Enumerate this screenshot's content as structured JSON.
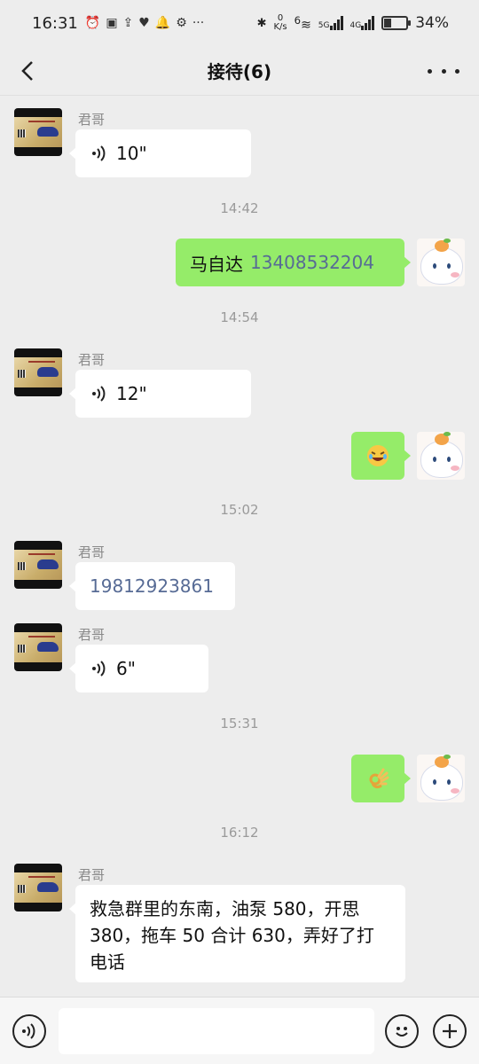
{
  "status_bar": {
    "time": "16:31",
    "net_speed_value": "0",
    "net_speed_unit": "K/s",
    "network_6": "6",
    "network_5g": "5G",
    "network_4g": "4G",
    "battery_percent": "34%",
    "battery_level": 0.34
  },
  "nav": {
    "title": "接待(6)"
  },
  "messages": {
    "m1": {
      "sender": "君哥",
      "voice_duration": "10\""
    },
    "t1": "14:42",
    "m2": {
      "name": "马自达",
      "phone": "13408532204"
    },
    "t2": "14:54",
    "m3": {
      "sender": "君哥",
      "voice_duration": "12\""
    },
    "m4": {
      "emoji": "rolling-on-floor-laughing"
    },
    "t3": "15:02",
    "m5": {
      "sender": "君哥",
      "phone": "19812923861"
    },
    "m6": {
      "sender": "君哥",
      "voice_duration": "6\""
    },
    "t4": "15:31",
    "m7": {
      "emoji": "ok-hand"
    },
    "t5": "16:12",
    "m8": {
      "sender": "君哥",
      "text": "救急群里的东南，油泵 580，开思 380，拖车 50 合计 630，弄好了打电话"
    }
  },
  "colors": {
    "background": "#ededed",
    "bubble_self": "#95ec69",
    "bubble_other": "#ffffff",
    "link": "#576b95"
  },
  "icons": {
    "back": "chevron-left-icon",
    "more": "more-dots-icon",
    "voice": "voice-wave-icon",
    "emoji": "smiley-icon",
    "add": "plus-icon"
  }
}
